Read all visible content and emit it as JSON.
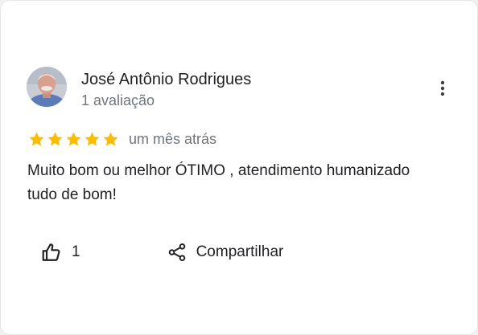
{
  "review": {
    "author_name": "José Antônio Rodrigues",
    "author_meta": "1 avaliação",
    "rating": 5,
    "rating_max": 5,
    "date": "um mês atrás",
    "text": "Muito bom ou melhor ÓTIMO , atendimento humanizado tudo de bom!"
  },
  "actions": {
    "like_count": "1",
    "share_label": "Compartilhar"
  },
  "icons": {
    "star": "star-icon",
    "menu": "more-vertical-icon",
    "like": "thumbs-up-icon",
    "share": "share-icon"
  },
  "colors": {
    "star": "#FBBC04",
    "secondary_text": "#70757a",
    "primary_text": "#202124"
  }
}
